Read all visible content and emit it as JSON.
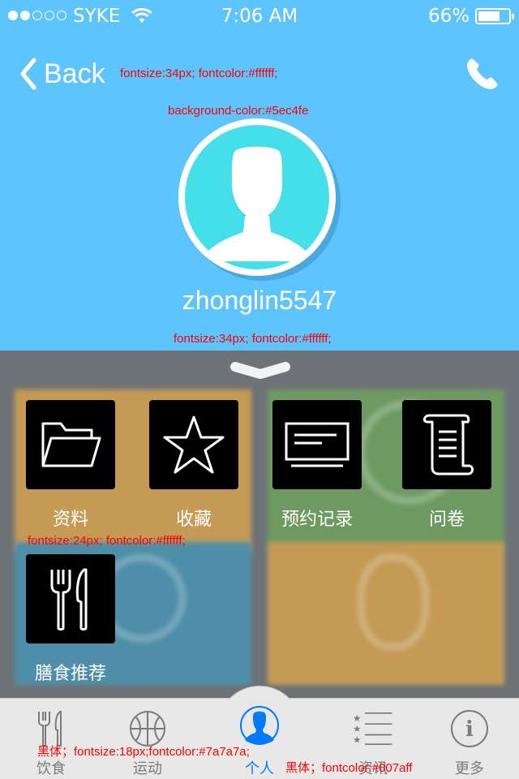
{
  "status_bar": {
    "carrier": "SYKE",
    "time": "7:06 AM",
    "battery": "66%",
    "battery_level": 0.66,
    "signal_bars": 2
  },
  "nav": {
    "back_label": "Back",
    "back_icon": "chevron-left-icon",
    "call_icon": "phone-icon"
  },
  "profile": {
    "username": "zhonglin5547",
    "avatar_icon": "user-silhouette-icon"
  },
  "menu": {
    "items": [
      {
        "label": "资料",
        "icon": "folder-icon"
      },
      {
        "label": "收藏",
        "icon": "star-icon"
      },
      {
        "label": "预约记录",
        "icon": "monitor-icon"
      },
      {
        "label": "问卷",
        "icon": "scroll-icon"
      },
      {
        "label": "膳食推荐",
        "icon": "fork-knife-icon"
      }
    ]
  },
  "tabbar": {
    "items": [
      {
        "label": "饮食",
        "icon": "fork-knife-icon"
      },
      {
        "label": "运动",
        "icon": "basketball-icon"
      },
      {
        "label": "个人",
        "icon": "person-icon",
        "active": true
      },
      {
        "label": "资讯",
        "icon": "list-icon"
      },
      {
        "label": "更多",
        "icon": "info-icon"
      }
    ]
  },
  "annotations": {
    "back": "fontsize:34px; fontcolor:#ffffff;",
    "header_bg": "background-color:#5ec4fe",
    "username": "fontsize:34px; fontcolor:#ffffff;",
    "menu_label": "fontsize:24px; fontcolor:#ffffff;",
    "tab_label": "黑体；fontsize:18px;fontcolor:#7a7a7a;",
    "tab_active": "黑体；fontcolor:#007aff"
  },
  "colors": {
    "header_bg": "#5ec4fe",
    "label_white": "#ffffff",
    "tab_inactive": "#7a7a7a",
    "tab_active": "#007aff",
    "annotation": "#ff0000"
  }
}
